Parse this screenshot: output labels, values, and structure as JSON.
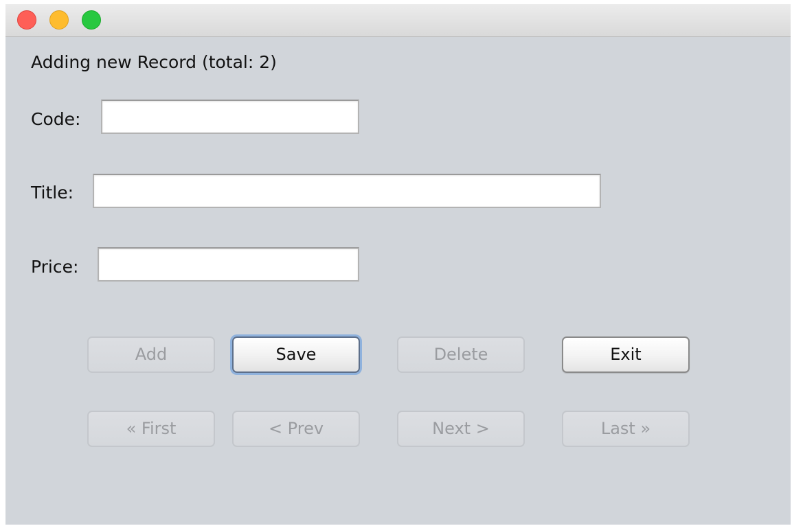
{
  "window": {
    "controls": [
      "close",
      "minimize",
      "zoom"
    ],
    "colors": {
      "close": "#fe5f57",
      "minimize": "#febc2e",
      "zoom": "#28c840",
      "focus_ring": "#8fb2dd"
    }
  },
  "status": {
    "text": "Adding new Record (total: 2)"
  },
  "form": {
    "code": {
      "label": "Code:",
      "value": "",
      "placeholder": ""
    },
    "title": {
      "label": "Title:",
      "value": "",
      "placeholder": ""
    },
    "price": {
      "label": "Price:",
      "value": "",
      "placeholder": ""
    }
  },
  "actions": {
    "add": {
      "label": "Add",
      "enabled": false
    },
    "save": {
      "label": "Save",
      "enabled": true,
      "focused": true
    },
    "delete": {
      "label": "Delete",
      "enabled": false
    },
    "exit": {
      "label": "Exit",
      "enabled": true
    }
  },
  "navigation": {
    "first": {
      "label": "« First",
      "enabled": false
    },
    "prev": {
      "label": "< Prev",
      "enabled": false
    },
    "next": {
      "label": "Next >",
      "enabled": false
    },
    "last": {
      "label": "Last »",
      "enabled": false
    }
  }
}
